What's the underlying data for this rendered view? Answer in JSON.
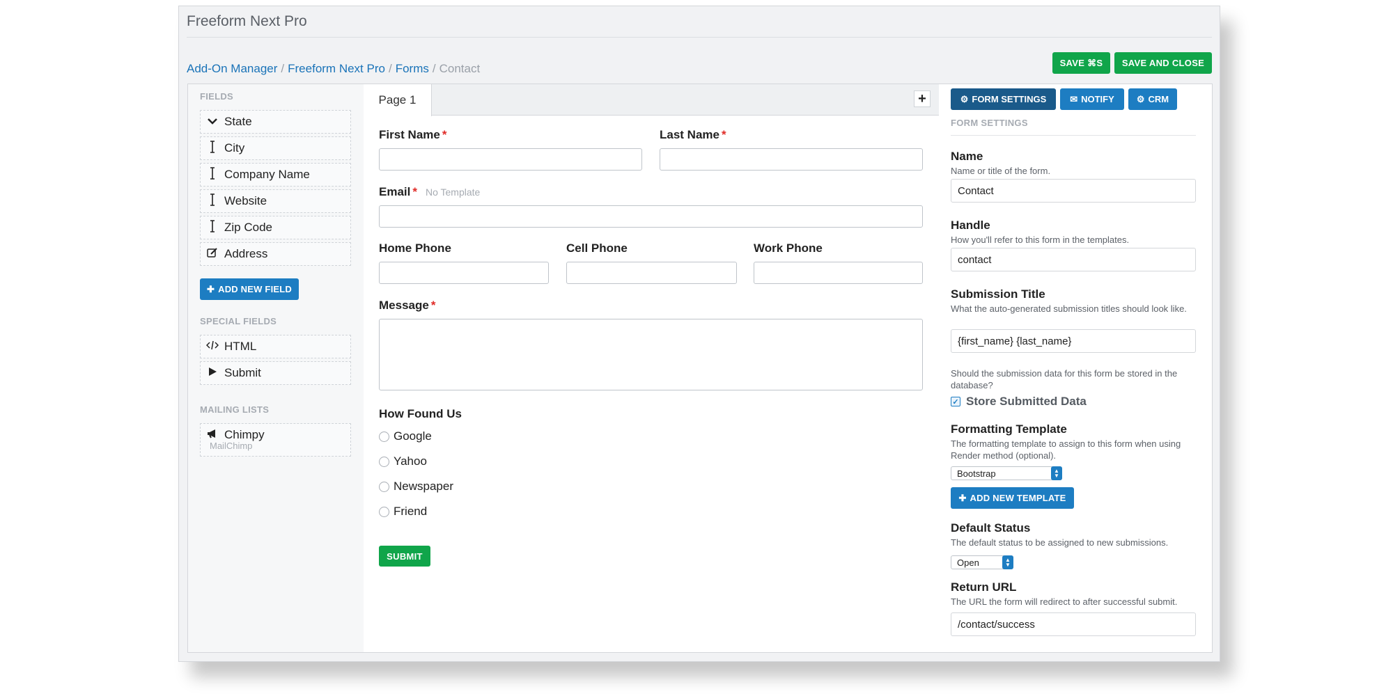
{
  "app": {
    "title": "Freeform Next Pro"
  },
  "breadcrumb": {
    "items": [
      "Add-On Manager",
      "Freeform Next Pro",
      "Forms"
    ],
    "current": "Contact",
    "separator": "/"
  },
  "toolbar": {
    "save_label": "SAVE ⌘S",
    "save_close_label": "SAVE AND CLOSE"
  },
  "sidebar": {
    "fields_title": "FIELDS",
    "fields": [
      {
        "label": "State",
        "icon": "chevron-down-icon"
      },
      {
        "label": "City",
        "icon": "text-cursor-icon"
      },
      {
        "label": "Company Name",
        "icon": "text-cursor-icon"
      },
      {
        "label": "Website",
        "icon": "text-cursor-icon"
      },
      {
        "label": "Zip Code",
        "icon": "text-cursor-icon"
      },
      {
        "label": "Address",
        "icon": "edit-icon"
      }
    ],
    "add_field_label": "ADD NEW FIELD",
    "special_title": "SPECIAL FIELDS",
    "special": [
      {
        "label": "HTML",
        "icon": "code-icon"
      },
      {
        "label": "Submit",
        "icon": "play-icon"
      }
    ],
    "mailing_title": "MAILING LISTS",
    "mailing": [
      {
        "label": "Chimpy",
        "sub": "MailChimp",
        "icon": "megaphone-icon"
      }
    ]
  },
  "form": {
    "tab": "Page 1",
    "add_page": "+",
    "first_name": "First Name",
    "last_name": "Last Name",
    "email": "Email",
    "email_note": "No Template",
    "home_phone": "Home Phone",
    "cell_phone": "Cell Phone",
    "work_phone": "Work Phone",
    "message": "Message",
    "required_mark": "*",
    "how_found": "How Found Us",
    "options": [
      "Google",
      "Yahoo",
      "Newspaper",
      "Friend"
    ],
    "submit": "SUBMIT"
  },
  "settings": {
    "tabs": [
      "FORM SETTINGS",
      "NOTIFY",
      "CRM"
    ],
    "section_title": "FORM SETTINGS",
    "name_label": "Name",
    "name_desc": "Name or title of the form.",
    "name_value": "Contact",
    "handle_label": "Handle",
    "handle_desc": "How you'll refer to this form in the templates.",
    "handle_value": "contact",
    "subtitle_label": "Submission Title",
    "subtitle_desc": "What the auto-generated submission titles should look like.",
    "subtitle_value": "{first_name} {last_name}",
    "store_desc": "Should the submission data for this form be stored in the database?",
    "store_label": "Store Submitted Data",
    "store_checked": true,
    "template_label": "Formatting Template",
    "template_desc": "The formatting template to assign to this form when using Render method (optional).",
    "template_value": "Bootstrap",
    "add_template_label": "ADD NEW TEMPLATE",
    "status_label": "Default Status",
    "status_desc": "The default status to be assigned to new submissions.",
    "status_value": "Open",
    "return_label": "Return URL",
    "return_desc": "The URL the form will redirect to after successful submit.",
    "return_value": "/contact/success"
  },
  "colors": {
    "green": "#10a54a",
    "blue": "#1d7dc2",
    "required": "#e02b27"
  }
}
